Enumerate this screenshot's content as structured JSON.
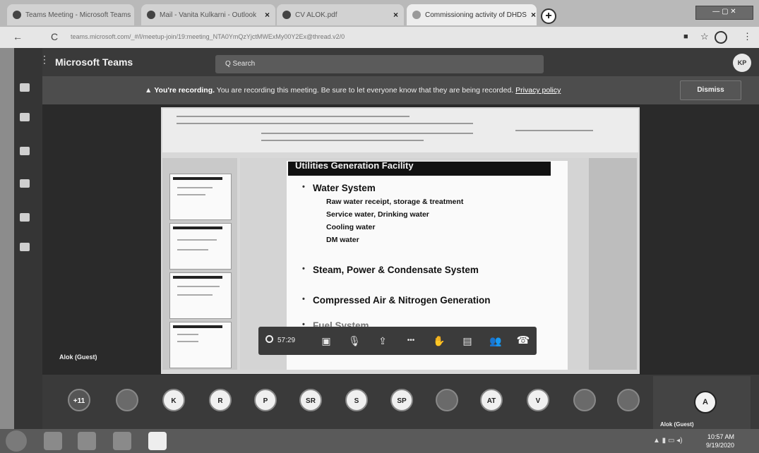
{
  "browser": {
    "tabs": [
      {
        "label": "Teams Meeting - Microsoft Teams",
        "close": "×"
      },
      {
        "label": "Mail - Vanita Kulkarni - Outlook",
        "close": "×"
      },
      {
        "label": "CV ALOK.pdf",
        "close": "×"
      },
      {
        "label": "Commissioning activity of DHDS",
        "close": "×"
      }
    ],
    "new_tab": "+",
    "url": "teams.microsoft.com/_#/l/meetup-join/19:meeting_NTA0YmQzYjctMWExMy00Y2Ex@thread.v2/0",
    "back": "←",
    "reload": "C"
  },
  "teams": {
    "app_title": "Microsoft Teams",
    "search_placeholder": "Q Search",
    "user_initials": "KP"
  },
  "banner": {
    "bold": "You're recording.",
    "text": " You are recording this meeting. Be sure to let everyone know that they are being recorded. ",
    "privacy": "Privacy policy",
    "dismiss": "Dismiss"
  },
  "slide": {
    "title": "Utilities Generation Facility",
    "bullets": [
      {
        "text": "Water System",
        "sub": [
          "Raw water receipt, storage & treatment",
          "Service water, Drinking water",
          "Cooling water",
          "DM water"
        ]
      },
      {
        "text": "Steam, Power & Condensate System",
        "sub": []
      },
      {
        "text": "Compressed Air & Nitrogen Generation",
        "sub": []
      },
      {
        "text": "Fuel System",
        "sub": []
      }
    ]
  },
  "controls": {
    "timer": "57:29",
    "video": "▣",
    "mic": "🎙",
    "share": "⇪",
    "more": "•••",
    "hand": "✋",
    "chat": "▤",
    "people": "👥",
    "hangup": "☎"
  },
  "stage_label": "Alok (Guest)",
  "participants": [
    "+11",
    "",
    "K",
    "R",
    "P",
    "SR",
    "S",
    "SP",
    "",
    "AT",
    "V",
    "",
    ""
  ],
  "self": {
    "initial": "A",
    "label": "Alok (Guest)"
  },
  "taskbar": {
    "time": "10:57 AM",
    "date": "9/19/2020"
  }
}
